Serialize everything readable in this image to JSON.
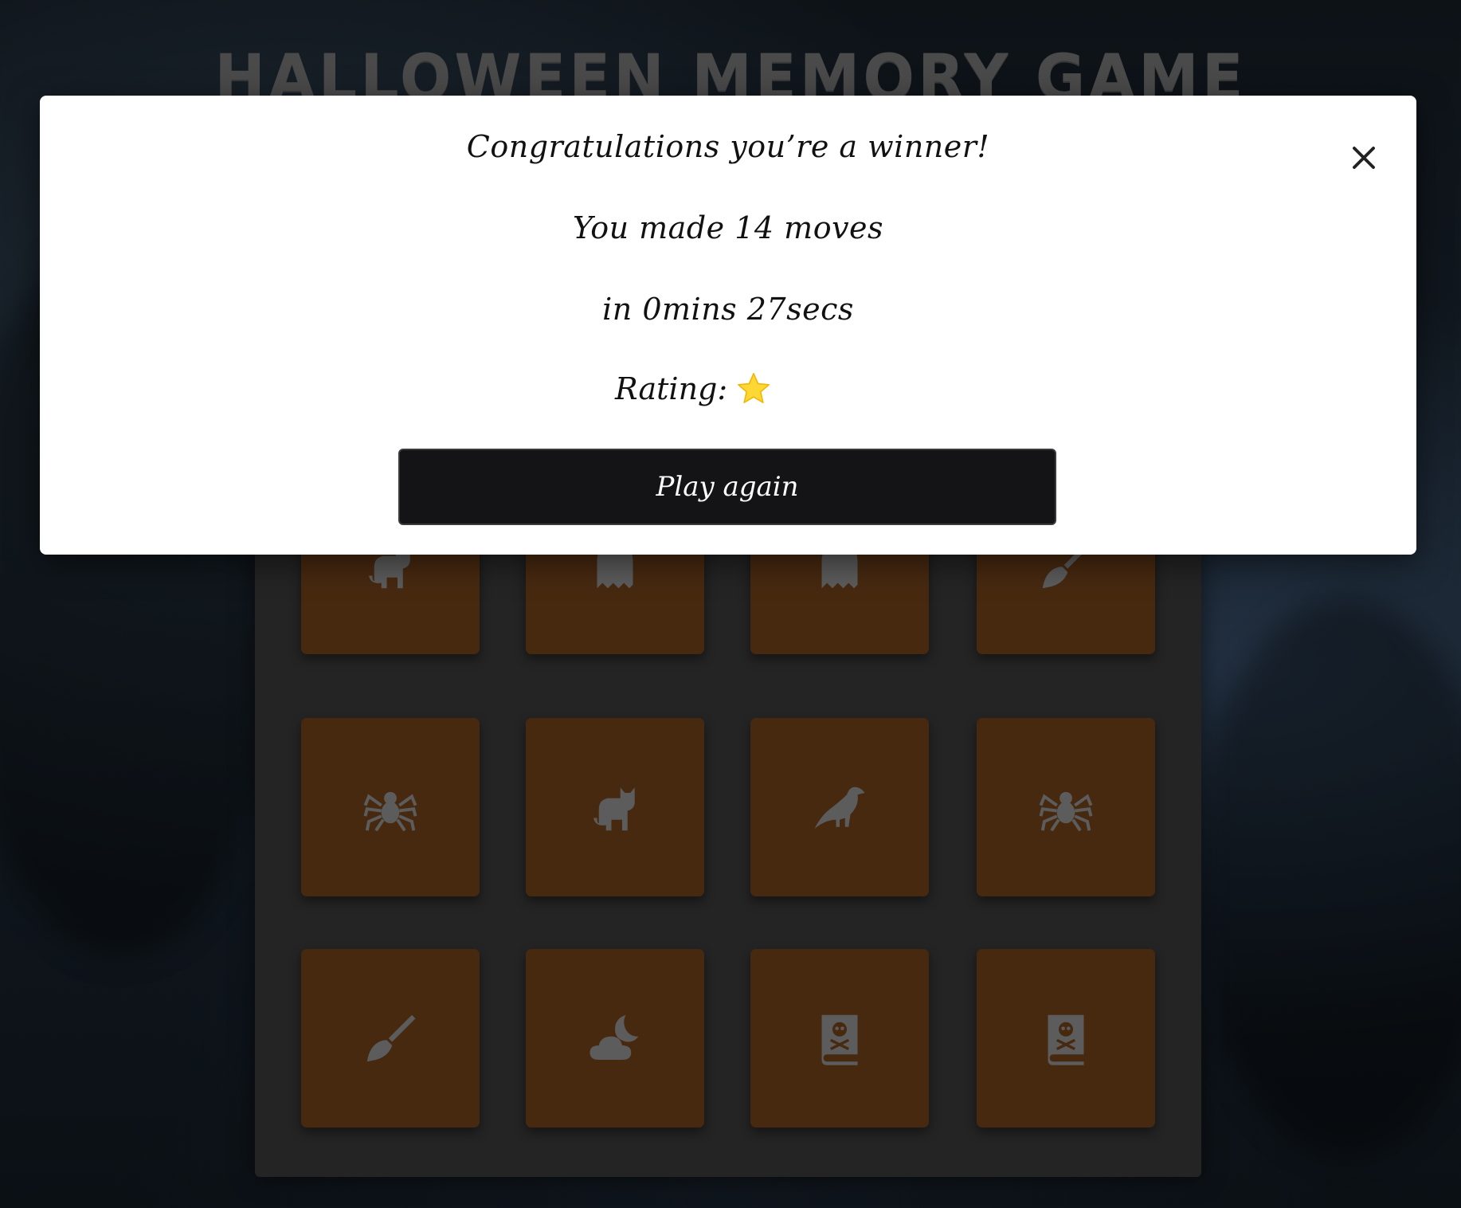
{
  "game": {
    "title": "HALLOWEEN MEMORY GAME"
  },
  "board": {
    "cards": [
      {
        "icon": "cat-icon"
      },
      {
        "icon": "ghost-icon"
      },
      {
        "icon": "ghost-icon"
      },
      {
        "icon": "broom-icon"
      },
      {
        "icon": "spider-icon"
      },
      {
        "icon": "cat-icon"
      },
      {
        "icon": "crow-icon"
      },
      {
        "icon": "spider-icon"
      },
      {
        "icon": "broom-icon"
      },
      {
        "icon": "cloud-moon-icon"
      },
      {
        "icon": "book-skull-icon"
      },
      {
        "icon": "book-skull-icon"
      }
    ],
    "card_color": "#472910",
    "icon_color": "#5c5c5c"
  },
  "modal": {
    "heading": "Congratulations you’re a winner!",
    "moves_text": "You made 14 moves",
    "time_text": "in 0mins 27secs",
    "rating_label": "Rating:",
    "rating_stars": 1,
    "star_icon": "star-icon",
    "close_icon": "close-icon",
    "play_again_label": "Play again"
  }
}
